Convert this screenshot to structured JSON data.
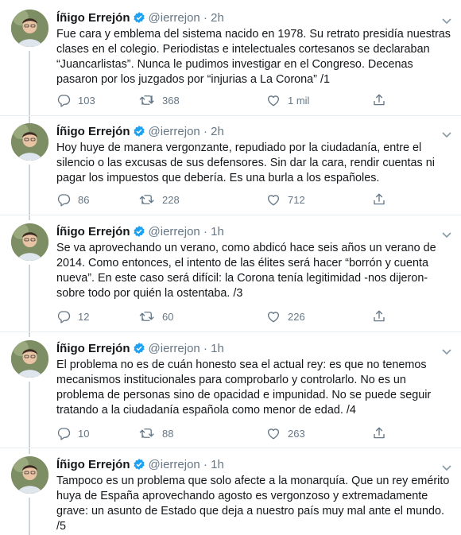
{
  "accent": "#1da1f2",
  "tweets": [
    {
      "author": "Íñigo Errejón",
      "handle": "@ierrejon",
      "time": "2h",
      "text": "Fue cara y emblema del sistema nacido en 1978. Su retrato presidía nuestras clases en el colegio. Periodistas e intelectuales cortesanos se declaraban “Juancarlistas”. Nunca le pudimos investigar en el Congreso. Decenas pasaron por los juzgados por “injurias a La Corona” /1",
      "replies": "103",
      "retweets": "368",
      "likes": "1 mil"
    },
    {
      "author": "Íñigo Errejón",
      "handle": "@ierrejon",
      "time": "2h",
      "text": "Hoy huye de manera vergonzante, repudiado por la ciudadanía, entre el silencio o las excusas de sus defensores. Sin dar la cara, rendir cuentas ni pagar los impuestos que debería. Es una burla a los españoles.",
      "replies": "86",
      "retweets": "228",
      "likes": "712"
    },
    {
      "author": "Íñigo Errejón",
      "handle": "@ierrejon",
      "time": "1h",
      "text": "Se va aprovechando un verano, como abdicó hace seis años un verano de 2014. Como entonces, el intento de las élites será hacer “borrón y cuenta nueva”. En este caso será difícil: la Corona tenía legitimidad -nos dijeron- sobre todo por quién la ostentaba. /3",
      "replies": "12",
      "retweets": "60",
      "likes": "226"
    },
    {
      "author": "Íñigo Errejón",
      "handle": "@ierrejon",
      "time": "1h",
      "text": "El problema no es de cuán honesto sea el actual rey: es que no tenemos mecanismos institucionales para comprobarlo y controlarlo. No es un problema de personas sino de opacidad e impunidad. No se puede seguir tratando a la ciudadanía española como menor de edad. /4",
      "replies": "10",
      "retweets": "88",
      "likes": "263"
    },
    {
      "author": "Íñigo Errejón",
      "handle": "@ierrejon",
      "time": "1h",
      "text": "Tampoco es un problema que solo afecte a la monarquía. Que un rey emérito huya de España aprovechando agosto es vergonzoso y extremadamente grave: un asunto de Estado que deja a nuestro país muy mal ante el mundo. /5"
    }
  ]
}
